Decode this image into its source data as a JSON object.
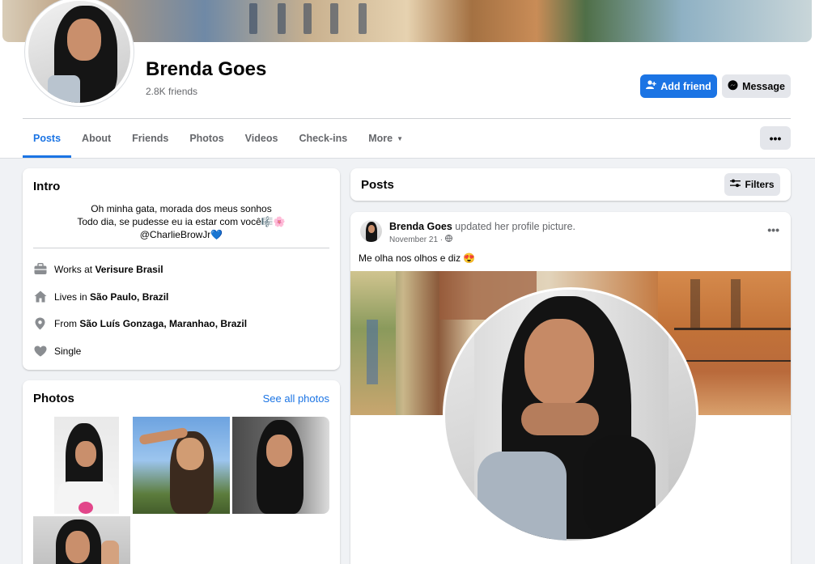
{
  "profile": {
    "name": "Brenda Goes",
    "friends_count": "2.8K friends",
    "add_friend_label": "Add friend",
    "message_label": "Message",
    "more_options_label": "•••"
  },
  "tabs": [
    {
      "label": "Posts",
      "active": true
    },
    {
      "label": "About"
    },
    {
      "label": "Friends"
    },
    {
      "label": "Photos"
    },
    {
      "label": "Videos"
    },
    {
      "label": "Check-ins"
    },
    {
      "label": "More"
    }
  ],
  "intro": {
    "title": "Intro",
    "bio_lines": [
      "Oh minha gata, morada dos meus sonhos",
      "Todo dia, se pudesse eu ia estar com você🎼🌸",
      "@CharlieBrowJr💙"
    ],
    "details": [
      {
        "prefix": "Works at",
        "value": "Verisure Brasil",
        "icon": "briefcase-icon"
      },
      {
        "prefix": "Lives in",
        "value": "São Paulo, Brazil",
        "icon": "home-icon"
      },
      {
        "prefix": "From",
        "value": "São Luís Gonzaga, Maranhao, Brazil",
        "icon": "location-pin-icon"
      },
      {
        "prefix": "",
        "value": "Single",
        "icon": "heart-icon"
      }
    ]
  },
  "photos_card": {
    "title": "Photos",
    "see_all": "See all photos"
  },
  "posts_header": {
    "title": "Posts",
    "filters_label": "Filters"
  },
  "post": {
    "author": "Brenda Goes",
    "action": "updated her profile picture.",
    "date": "November 21 ·",
    "menu": "•••",
    "text": "Me olha nos olhos e diz 😍"
  },
  "colors": {
    "accent": "#1b74e4",
    "background": "#f0f2f5",
    "secondary_text": "#65676b"
  }
}
